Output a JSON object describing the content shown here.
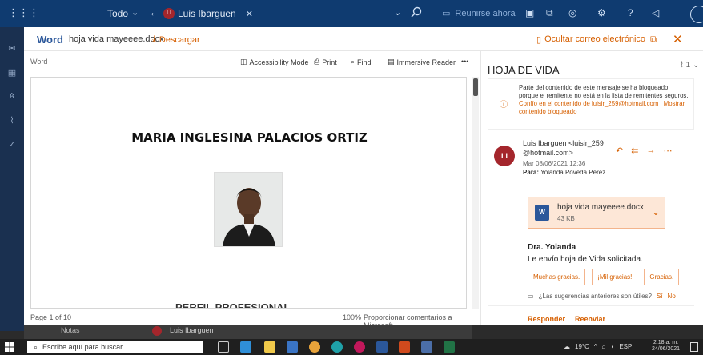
{
  "topbar": {
    "folder_label": "Todo",
    "search_chip_initials": "LI",
    "search_chip_name": "Luis Ibarguen",
    "meet_label": "Reunirse ahora"
  },
  "viewer": {
    "app_title": "Word",
    "file_name": "hoja vida mayeeee.docx",
    "download_label": "Descargar",
    "hide_email_label": "Ocultar correo electrónico",
    "toolbar": {
      "app_label": "Word",
      "accessibility": "Accessibility Mode",
      "print": "Print",
      "find": "Find",
      "immersive": "Immersive Reader",
      "more": "•••"
    },
    "document": {
      "title": "MARIA INGLESINA PALACIOS ORTIZ",
      "bottom_title": "PERFIL PROFESIONAL"
    },
    "status": {
      "page": "Page 1 of 10",
      "zoom": "100%",
      "feedback": "Proporcionar comentarios a Microsoft"
    }
  },
  "reading_pane": {
    "title": "HOJA DE VIDA",
    "attachment_count": "1",
    "blocked_notice": "Parte del contenido de este mensaje se ha bloqueado porque el remitente no está en la lista de remitentes seguros.",
    "trust_link": "Confío en el contenido de luisir_259@hotmail.com",
    "show_link": "Mostrar contenido bloqueado",
    "link_separator": "|",
    "sender_initials": "LI",
    "sender": "Luis Ibarguen <luisir_259 @hotmail.com>",
    "date": "Mar 08/06/2021 12:36",
    "to_label": "Para:",
    "to": "Yolanda Poveda Perez",
    "attachment": {
      "name": "hoja vida mayeeee.docx",
      "size": "43 KB"
    },
    "body_greeting": "Dra. Yolanda",
    "body_text": "Le envío hoja de Vida solicitada.",
    "quick_replies": [
      "Muchas gracias.",
      "¡Mil gracias!",
      "Gracias."
    ],
    "suggestions_question": "¿Las sugerencias anteriores son útiles?",
    "suggestions_yes": "Sí",
    "suggestions_no": "No",
    "reply": "Responder",
    "forward": "Reenviar"
  },
  "background_list": {
    "notas": "Notas",
    "sender": "Luis Ibarguen"
  },
  "taskbar": {
    "search_placeholder": "Escribe aquí para buscar",
    "weather": "19°C",
    "language": "ESP",
    "time": "2:18 a. m.",
    "date": "24/06/2021"
  },
  "colors": {
    "accent": "#d65f00",
    "outlook_bar": "#0f3b70",
    "word_blue": "#2b579a",
    "avatar": "#a4262c"
  }
}
